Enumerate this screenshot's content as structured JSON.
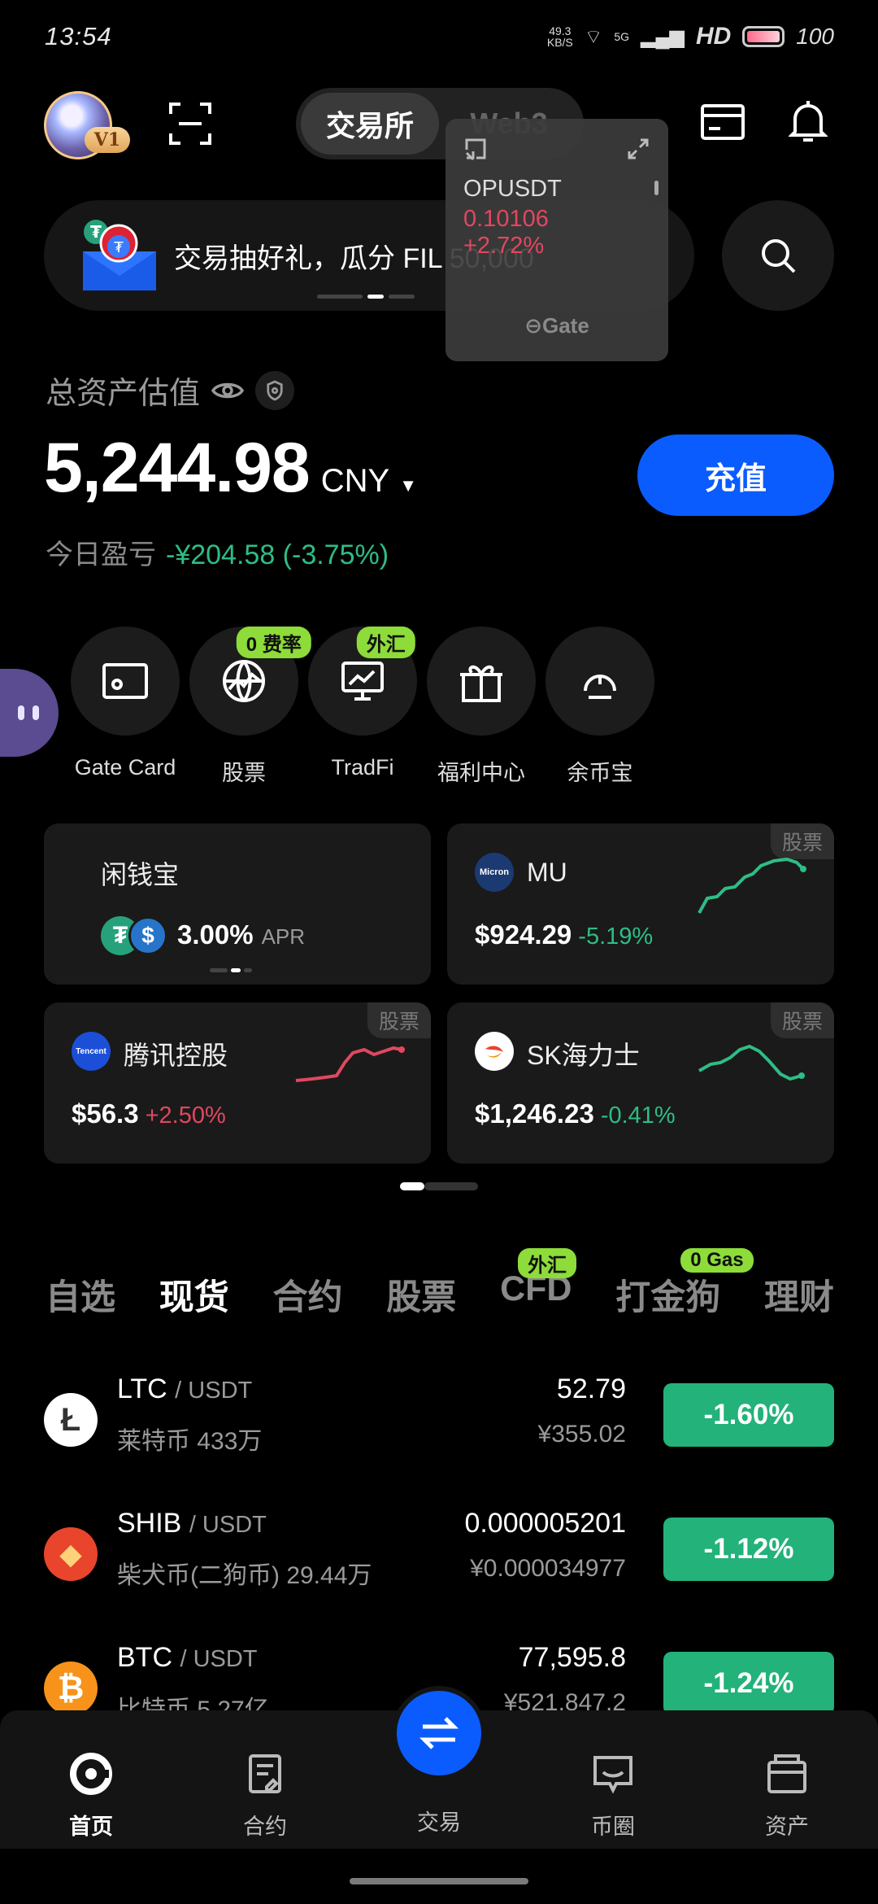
{
  "status_bar": {
    "time": "13:54",
    "net_speed_value": "49.3",
    "net_speed_unit": "KB/S",
    "signal": "5G",
    "hd": "HD",
    "battery": "100"
  },
  "header": {
    "tab_active": "交易所",
    "tab_inactive": "Web3",
    "avatar_level": "V1"
  },
  "float_ticker": {
    "symbol": "OPUSDT",
    "price": "0.10106",
    "change": "+2.72%",
    "brand": "Gate"
  },
  "banner": {
    "text": "交易抽好礼，瓜分 FIL 50,000"
  },
  "assets": {
    "label": "总资产估值",
    "value": "5,244.98",
    "currency": "CNY",
    "pnl_label": "今日盈亏",
    "pnl_value": "-¥204.58 (-3.75%)",
    "deposit_label": "充值"
  },
  "shortcuts": [
    {
      "label": "Gate Card",
      "icon": "card-icon",
      "tag": ""
    },
    {
      "label": "股票",
      "icon": "globe-icon",
      "tag": "0 费率"
    },
    {
      "label": "TradFi",
      "icon": "chart-monitor-icon",
      "tag": "外汇"
    },
    {
      "label": "福利中心",
      "icon": "gift-icon",
      "tag": ""
    },
    {
      "label": "余币宝",
      "icon": "savings-icon",
      "tag": ""
    }
  ],
  "cards": {
    "earn": {
      "title": "闲钱宝",
      "apr": "3.00%",
      "apr_label": "APR"
    },
    "mu": {
      "name": "MU",
      "price": "$924.29",
      "change": "-5.19%",
      "tag": "股票",
      "logo": "Micron"
    },
    "tencent": {
      "name": "腾讯控股",
      "price": "$56.3",
      "change": "+2.50%",
      "tag": "股票",
      "logo": "Tencent"
    },
    "sk": {
      "name": "SK海力士",
      "price": "$1,246.23",
      "change": "-0.41%",
      "tag": "股票"
    }
  },
  "market_tabs": [
    {
      "label": "自选",
      "tag": ""
    },
    {
      "label": "现货",
      "tag": "",
      "active": true
    },
    {
      "label": "合约",
      "tag": ""
    },
    {
      "label": "股票",
      "tag": ""
    },
    {
      "label": "CFD",
      "tag": "外汇"
    },
    {
      "label": "打金狗",
      "tag": "0 Gas"
    },
    {
      "label": "理财",
      "tag": ""
    }
  ],
  "coins": [
    {
      "base": "LTC",
      "quote": "/ USDT",
      "name": "莱特币 433万",
      "last": "52.79",
      "cny": "¥355.02",
      "change": "-1.60%",
      "color": "#ffffff"
    },
    {
      "base": "SHIB",
      "quote": "/ USDT",
      "name": "柴犬币(二狗币) 29.44万",
      "last": "0.000005201",
      "cny": "¥0.000034977",
      "change": "-1.12%",
      "color": "#e8452c"
    },
    {
      "base": "BTC",
      "quote": "/ USDT",
      "name": "比特币 5.27亿",
      "last": "77,595.8",
      "cny": "¥521,847.2",
      "change": "-1.24%",
      "color": "#f7931a"
    }
  ],
  "bottom_nav": [
    {
      "label": "首页",
      "icon": "home-icon",
      "active": true
    },
    {
      "label": "合约",
      "icon": "contract-icon"
    },
    {
      "label": "交易",
      "icon": "swap-icon"
    },
    {
      "label": "币圈",
      "icon": "community-icon"
    },
    {
      "label": "资产",
      "icon": "wallet-icon"
    }
  ],
  "colors": {
    "accent": "#0a5cff",
    "up": "#e0485f",
    "down": "#2ebd85",
    "tag": "#8ddc3a"
  }
}
